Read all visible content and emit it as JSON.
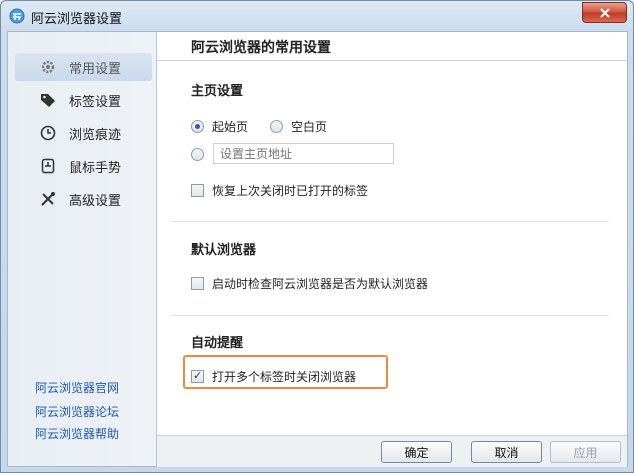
{
  "window": {
    "title": "阿云浏览器设置"
  },
  "sidebar": {
    "items": [
      {
        "label": "常用设置",
        "icon": "gear-icon",
        "active": true
      },
      {
        "label": "标签设置",
        "icon": "tag-icon"
      },
      {
        "label": "浏览痕迹",
        "icon": "clock-icon"
      },
      {
        "label": "鼠标手势",
        "icon": "mouse-gesture-icon"
      },
      {
        "label": "高级设置",
        "icon": "tools-icon"
      }
    ],
    "links": [
      "阿云浏览器官网",
      "阿云浏览器论坛",
      "阿云浏览器帮助"
    ]
  },
  "content": {
    "title": "阿云浏览器的常用设置",
    "homepage": {
      "title": "主页设置",
      "start_page": "起始页",
      "blank_page": "空白页",
      "url_placeholder": "设置主页地址",
      "restore_tabs": "恢复上次关闭时已打开的标签"
    },
    "default_browser": {
      "title": "默认浏览器",
      "check_default": "启动时检查阿云浏览器是否为默认浏览器"
    },
    "reminder": {
      "title": "自动提醒",
      "close_multi_tabs": "打开多个标签时关闭浏览器"
    }
  },
  "footer": {
    "ok": "确定",
    "cancel": "取消",
    "apply": "应用"
  },
  "colors": {
    "accent": "#2b5ea8",
    "highlight": "#f08a3a",
    "link": "#1a5aa8"
  }
}
